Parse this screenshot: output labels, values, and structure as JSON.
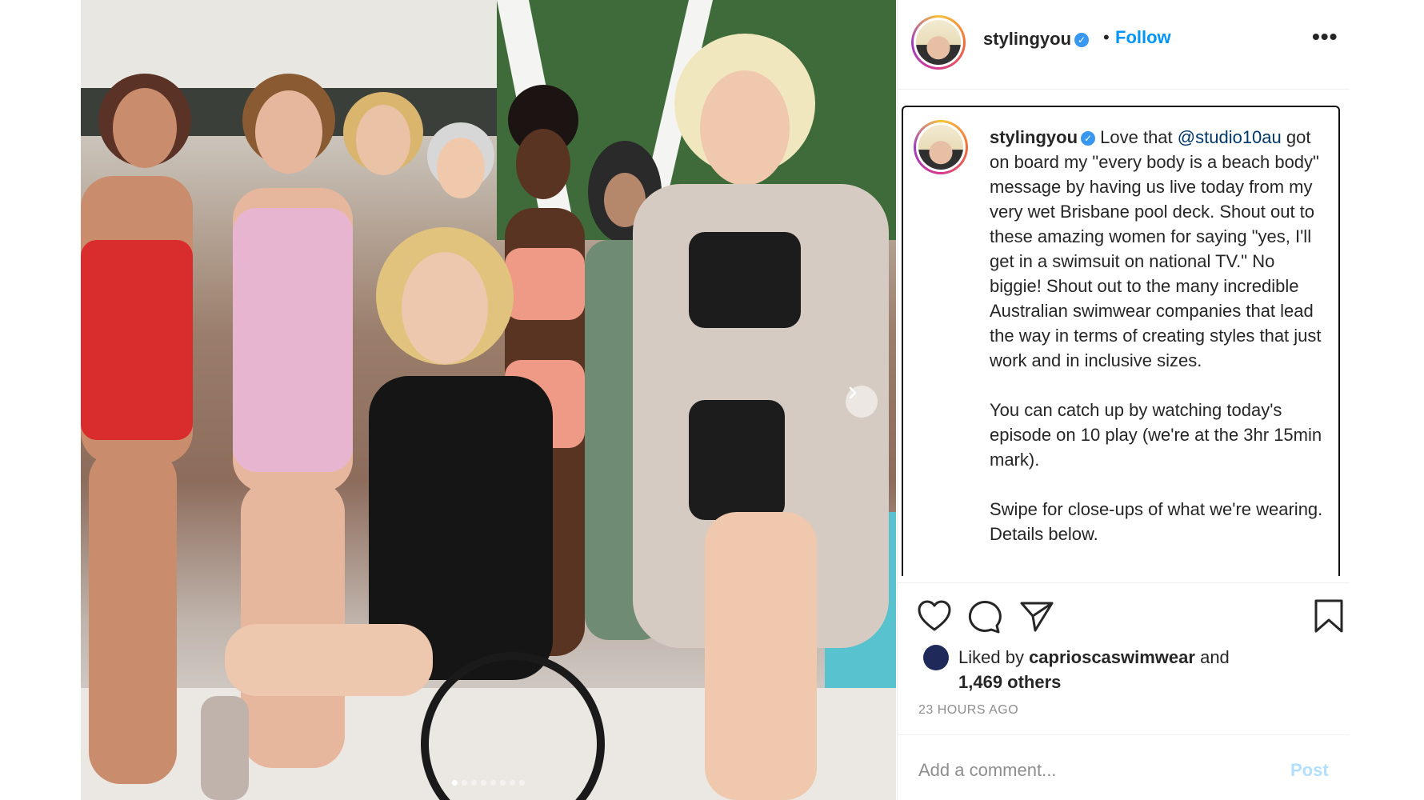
{
  "post": {
    "username": "stylingyou",
    "verified_icon": "verified-badge-icon",
    "separator": "•",
    "follow_label": "Follow",
    "more_label": "•••"
  },
  "caption": {
    "username": "stylingyou",
    "text_1": "Love that ",
    "mention": "@studio10au",
    "text_2": " got on board my \"every body is a beach body\" message by having us live today from my very wet Brisbane pool deck. Shout out to these amazing women for saying \"yes, I'll get in a swimsuit on national TV.\" No biggie! Shout out to the many incredible Australian swimwear companies that lead the way in terms of creating styles that just work and in inclusive sizes.\n\nYou can catch up by watching today's episode on 10 play (we're at the 3hr 15min mark).\n\nSwipe for close-ups of what we're wearing. Details below."
  },
  "likes": {
    "prefix": "Liked by ",
    "liker": "caprioscaswimwear",
    "middle": " and ",
    "others": "1,469 others"
  },
  "timestamp": "23 HOURS AGO",
  "comment": {
    "placeholder": "Add a comment...",
    "post_label": "Post"
  },
  "carousel": {
    "current": 1,
    "total": 8
  },
  "colors": {
    "follow": "#0095f6",
    "mention": "#00376b",
    "post_disabled": "#b2dffc",
    "muted": "#8e8e8e"
  }
}
